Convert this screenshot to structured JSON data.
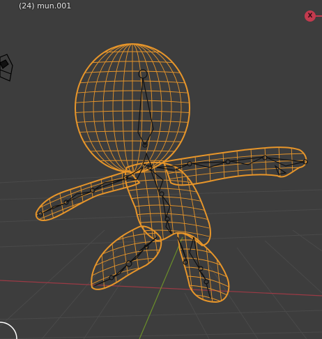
{
  "viewport": {
    "object_label": "(24) mun.001",
    "background_color": "#3d3d3d",
    "grid_color": "#4a4a4a",
    "x_axis_color": "#9b3a45",
    "y_axis_color": "#6b8f2a",
    "wireframe_color": "#e8962a",
    "armature_color": "#111111"
  },
  "gizmo": {
    "x_axis_label": "X",
    "x_axis_color": "#c33a4e"
  },
  "icons": {
    "camera": "camera-icon",
    "navigation": "navigation-circle-icon"
  }
}
